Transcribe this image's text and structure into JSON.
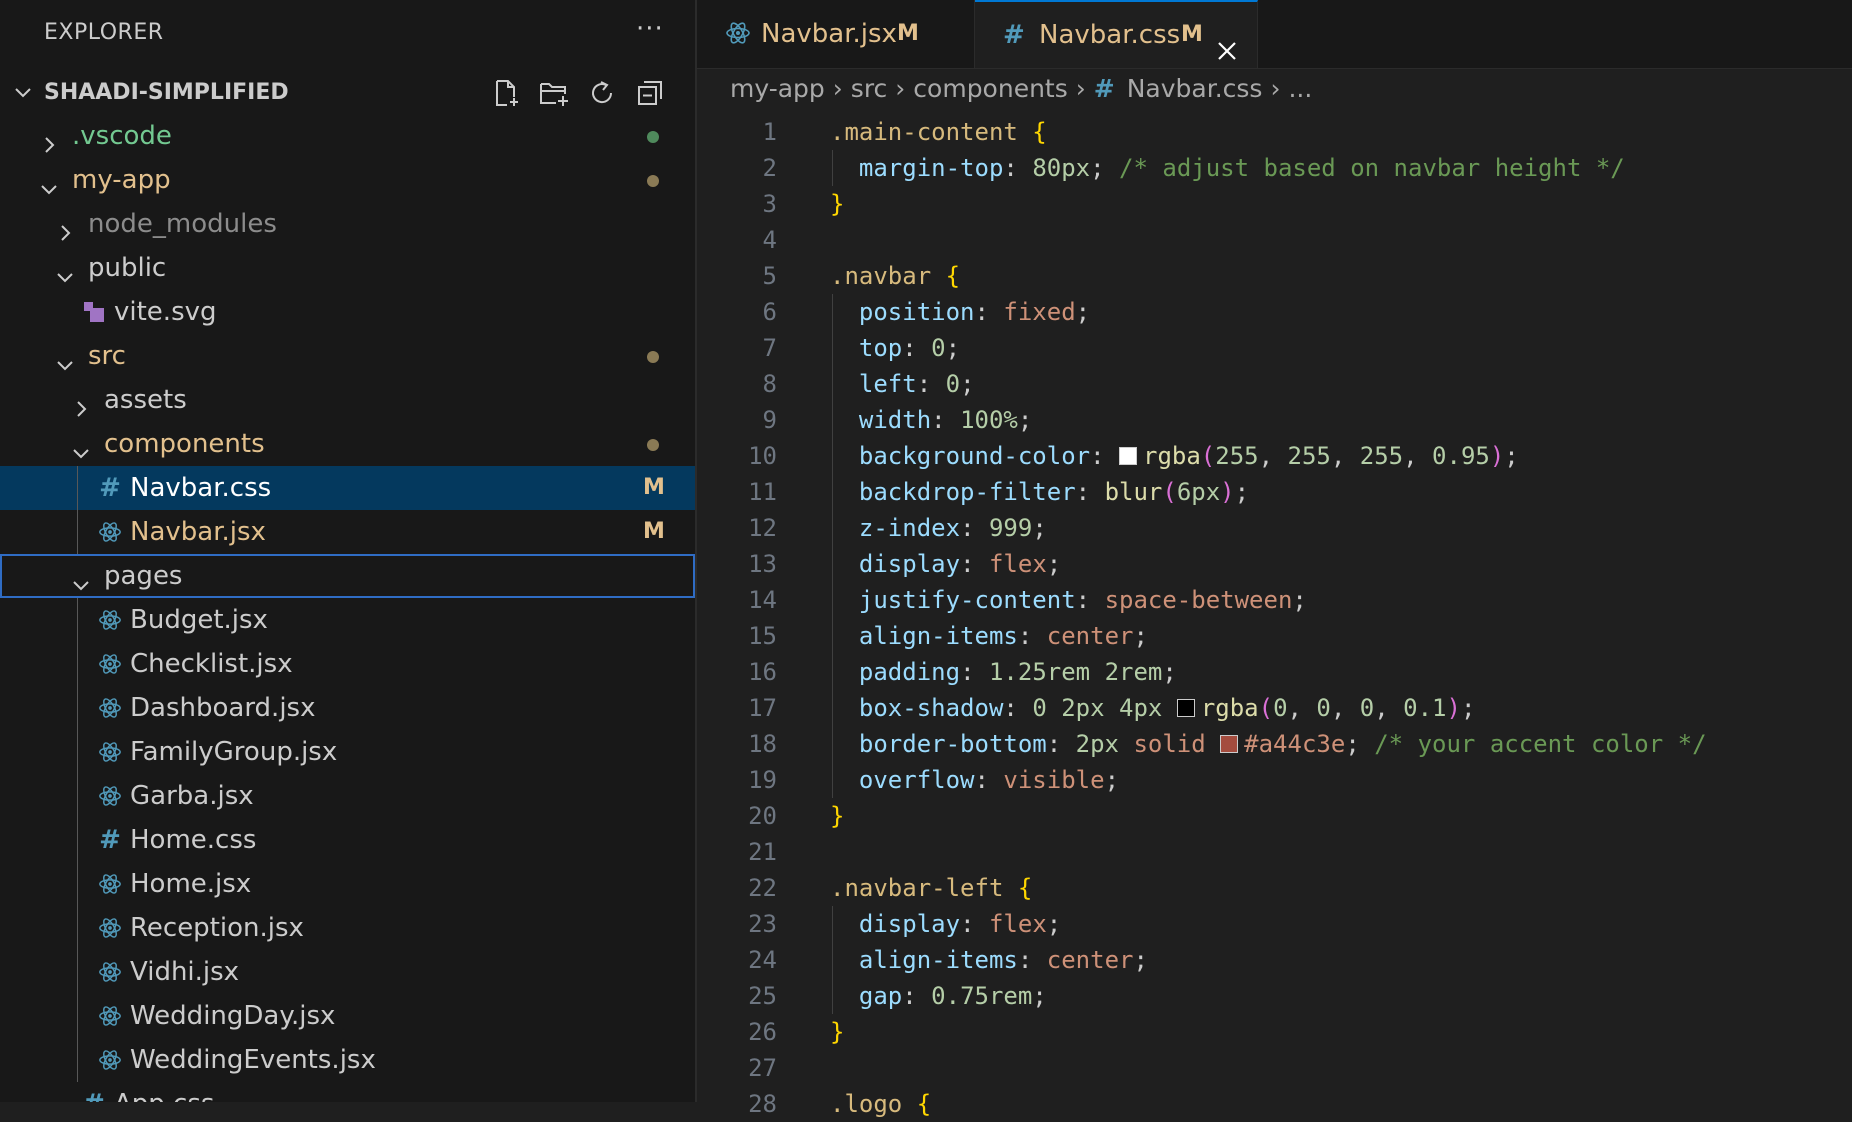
{
  "explorer": {
    "title": "EXPLORER",
    "more": "···",
    "root": "SHAADI-SIMPLIFIED",
    "actions": [
      {
        "name": "new-file-icon"
      },
      {
        "name": "new-folder-icon"
      },
      {
        "name": "refresh-icon"
      },
      {
        "name": "collapse-all-icon"
      }
    ],
    "tree": [
      {
        "label": ".vscode",
        "type": "folder",
        "expanded": false,
        "depth": 0,
        "color": "git",
        "dot": "#4f8a5c"
      },
      {
        "label": "my-app",
        "type": "folder",
        "expanded": true,
        "depth": 0,
        "color": "mod",
        "dot": "#8a7a55"
      },
      {
        "label": "node_modules",
        "type": "folder",
        "expanded": false,
        "depth": 1,
        "color": "dim"
      },
      {
        "label": "public",
        "type": "folder",
        "expanded": true,
        "depth": 1,
        "color": "norm"
      },
      {
        "label": "vite.svg",
        "type": "file",
        "icon": "svg",
        "depth": 2,
        "color": "norm"
      },
      {
        "label": "src",
        "type": "folder",
        "expanded": true,
        "depth": 1,
        "color": "mod",
        "dot": "#8a7a55"
      },
      {
        "label": "assets",
        "type": "folder",
        "expanded": false,
        "depth": 2,
        "color": "norm"
      },
      {
        "label": "components",
        "type": "folder",
        "expanded": true,
        "depth": 2,
        "color": "mod",
        "dot": "#8a7a55"
      },
      {
        "label": "Navbar.css",
        "type": "file",
        "icon": "css",
        "depth": 3,
        "color": "white",
        "badge": "M",
        "selected": true
      },
      {
        "label": "Navbar.jsx",
        "type": "file",
        "icon": "react",
        "depth": 3,
        "color": "mod",
        "badge": "M"
      },
      {
        "label": "pages",
        "type": "folder",
        "expanded": true,
        "depth": 2,
        "color": "norm",
        "focused": true
      },
      {
        "label": "Budget.jsx",
        "type": "file",
        "icon": "react",
        "depth": 3,
        "color": "norm"
      },
      {
        "label": "Checklist.jsx",
        "type": "file",
        "icon": "react",
        "depth": 3,
        "color": "norm"
      },
      {
        "label": "Dashboard.jsx",
        "type": "file",
        "icon": "react",
        "depth": 3,
        "color": "norm"
      },
      {
        "label": "FamilyGroup.jsx",
        "type": "file",
        "icon": "react",
        "depth": 3,
        "color": "norm"
      },
      {
        "label": "Garba.jsx",
        "type": "file",
        "icon": "react",
        "depth": 3,
        "color": "norm"
      },
      {
        "label": "Home.css",
        "type": "file",
        "icon": "css",
        "depth": 3,
        "color": "norm"
      },
      {
        "label": "Home.jsx",
        "type": "file",
        "icon": "react",
        "depth": 3,
        "color": "norm"
      },
      {
        "label": "Reception.jsx",
        "type": "file",
        "icon": "react",
        "depth": 3,
        "color": "norm"
      },
      {
        "label": "Vidhi.jsx",
        "type": "file",
        "icon": "react",
        "depth": 3,
        "color": "norm"
      },
      {
        "label": "WeddingDay.jsx",
        "type": "file",
        "icon": "react",
        "depth": 3,
        "color": "norm"
      },
      {
        "label": "WeddingEvents.jsx",
        "type": "file",
        "icon": "react",
        "depth": 3,
        "color": "norm"
      },
      {
        "label": "App.css",
        "type": "file",
        "icon": "css",
        "depth": 2,
        "color": "norm"
      }
    ]
  },
  "tabs": [
    {
      "label": "Navbar.jsx",
      "icon": "react",
      "modified": "M",
      "active": false
    },
    {
      "label": "Navbar.css",
      "icon": "css",
      "modified": "M",
      "active": true
    }
  ],
  "breadcrumb": [
    "my-app",
    "src",
    "components",
    "Navbar.css",
    "..."
  ],
  "colors": {
    "accent": "#0078d4",
    "modified": "#e2c08d",
    "untracked": "#73c991",
    "selection": "#04395e",
    "swatch_white": "#ffffff",
    "swatch_shadow": "#000000",
    "swatch_accent": "#a44c3e"
  },
  "code": [
    [
      [
        "t-sel",
        ".main-content "
      ],
      [
        "t-brace",
        "{"
      ]
    ],
    [
      [
        "ind",
        ""
      ],
      [
        "t-prop",
        "margin-top"
      ],
      [
        "t-pun",
        ": "
      ],
      [
        "t-num",
        "80px"
      ],
      [
        "t-pun",
        "; "
      ],
      [
        "t-com",
        "/* adjust based on navbar height */"
      ]
    ],
    [
      [
        "t-brace",
        "}"
      ]
    ],
    [],
    [
      [
        "t-sel",
        ".navbar "
      ],
      [
        "t-brace",
        "{"
      ]
    ],
    [
      [
        "ind",
        ""
      ],
      [
        "t-prop",
        "position"
      ],
      [
        "t-pun",
        ": "
      ],
      [
        "t-val",
        "fixed"
      ],
      [
        "t-pun",
        ";"
      ]
    ],
    [
      [
        "ind",
        ""
      ],
      [
        "t-prop",
        "top"
      ],
      [
        "t-pun",
        ": "
      ],
      [
        "t-num",
        "0"
      ],
      [
        "t-pun",
        ";"
      ]
    ],
    [
      [
        "ind",
        ""
      ],
      [
        "t-prop",
        "left"
      ],
      [
        "t-pun",
        ": "
      ],
      [
        "t-num",
        "0"
      ],
      [
        "t-pun",
        ";"
      ]
    ],
    [
      [
        "ind",
        ""
      ],
      [
        "t-prop",
        "width"
      ],
      [
        "t-pun",
        ": "
      ],
      [
        "t-num",
        "100%"
      ],
      [
        "t-pun",
        ";"
      ]
    ],
    [
      [
        "ind",
        ""
      ],
      [
        "t-prop",
        "background-color"
      ],
      [
        "t-pun",
        ": "
      ],
      [
        "swatch",
        "#ffffff"
      ],
      [
        "t-fn",
        "rgba"
      ],
      [
        "t-paren",
        "("
      ],
      [
        "t-num",
        "255"
      ],
      [
        "t-pun",
        ", "
      ],
      [
        "t-num",
        "255"
      ],
      [
        "t-pun",
        ", "
      ],
      [
        "t-num",
        "255"
      ],
      [
        "t-pun",
        ", "
      ],
      [
        "t-num",
        "0.95"
      ],
      [
        "t-paren",
        ")"
      ],
      [
        "t-pun",
        ";"
      ]
    ],
    [
      [
        "ind",
        ""
      ],
      [
        "t-prop",
        "backdrop-filter"
      ],
      [
        "t-pun",
        ": "
      ],
      [
        "t-fn",
        "blur"
      ],
      [
        "t-paren",
        "("
      ],
      [
        "t-num",
        "6px"
      ],
      [
        "t-paren",
        ")"
      ],
      [
        "t-pun",
        ";"
      ]
    ],
    [
      [
        "ind",
        ""
      ],
      [
        "t-prop",
        "z-index"
      ],
      [
        "t-pun",
        ": "
      ],
      [
        "t-num",
        "999"
      ],
      [
        "t-pun",
        ";"
      ]
    ],
    [
      [
        "ind",
        ""
      ],
      [
        "t-prop",
        "display"
      ],
      [
        "t-pun",
        ": "
      ],
      [
        "t-val",
        "flex"
      ],
      [
        "t-pun",
        ";"
      ]
    ],
    [
      [
        "ind",
        ""
      ],
      [
        "t-prop",
        "justify-content"
      ],
      [
        "t-pun",
        ": "
      ],
      [
        "t-val",
        "space-between"
      ],
      [
        "t-pun",
        ";"
      ]
    ],
    [
      [
        "ind",
        ""
      ],
      [
        "t-prop",
        "align-items"
      ],
      [
        "t-pun",
        ": "
      ],
      [
        "t-val",
        "center"
      ],
      [
        "t-pun",
        ";"
      ]
    ],
    [
      [
        "ind",
        ""
      ],
      [
        "t-prop",
        "padding"
      ],
      [
        "t-pun",
        ": "
      ],
      [
        "t-num",
        "1.25rem 2rem"
      ],
      [
        "t-pun",
        ";"
      ]
    ],
    [
      [
        "ind",
        ""
      ],
      [
        "t-prop",
        "box-shadow"
      ],
      [
        "t-pun",
        ": "
      ],
      [
        "t-num",
        "0 2px 4px "
      ],
      [
        "swatch",
        "#000000"
      ],
      [
        "t-fn",
        "rgba"
      ],
      [
        "t-paren",
        "("
      ],
      [
        "t-num",
        "0"
      ],
      [
        "t-pun",
        ", "
      ],
      [
        "t-num",
        "0"
      ],
      [
        "t-pun",
        ", "
      ],
      [
        "t-num",
        "0"
      ],
      [
        "t-pun",
        ", "
      ],
      [
        "t-num",
        "0.1"
      ],
      [
        "t-paren",
        ")"
      ],
      [
        "t-pun",
        ";"
      ]
    ],
    [
      [
        "ind",
        ""
      ],
      [
        "t-prop",
        "border-bottom"
      ],
      [
        "t-pun",
        ": "
      ],
      [
        "t-num",
        "2px "
      ],
      [
        "t-val",
        "solid "
      ],
      [
        "swatch",
        "#a44c3e"
      ],
      [
        "t-val",
        "#a44c3e"
      ],
      [
        "t-pun",
        "; "
      ],
      [
        "t-com",
        "/* your accent color */"
      ]
    ],
    [
      [
        "ind",
        ""
      ],
      [
        "t-prop",
        "overflow"
      ],
      [
        "t-pun",
        ": "
      ],
      [
        "t-val",
        "visible"
      ],
      [
        "t-pun",
        ";"
      ]
    ],
    [
      [
        "t-brace",
        "}"
      ]
    ],
    [],
    [
      [
        "t-sel",
        ".navbar-left "
      ],
      [
        "t-brace",
        "{"
      ]
    ],
    [
      [
        "ind",
        ""
      ],
      [
        "t-prop",
        "display"
      ],
      [
        "t-pun",
        ": "
      ],
      [
        "t-val",
        "flex"
      ],
      [
        "t-pun",
        ";"
      ]
    ],
    [
      [
        "ind",
        ""
      ],
      [
        "t-prop",
        "align-items"
      ],
      [
        "t-pun",
        ": "
      ],
      [
        "t-val",
        "center"
      ],
      [
        "t-pun",
        ";"
      ]
    ],
    [
      [
        "ind",
        ""
      ],
      [
        "t-prop",
        "gap"
      ],
      [
        "t-pun",
        ": "
      ],
      [
        "t-num",
        "0.75rem"
      ],
      [
        "t-pun",
        ";"
      ]
    ],
    [
      [
        "t-brace",
        "}"
      ]
    ],
    [],
    [
      [
        "t-sel",
        ".logo "
      ],
      [
        "t-brace",
        "{"
      ]
    ]
  ]
}
